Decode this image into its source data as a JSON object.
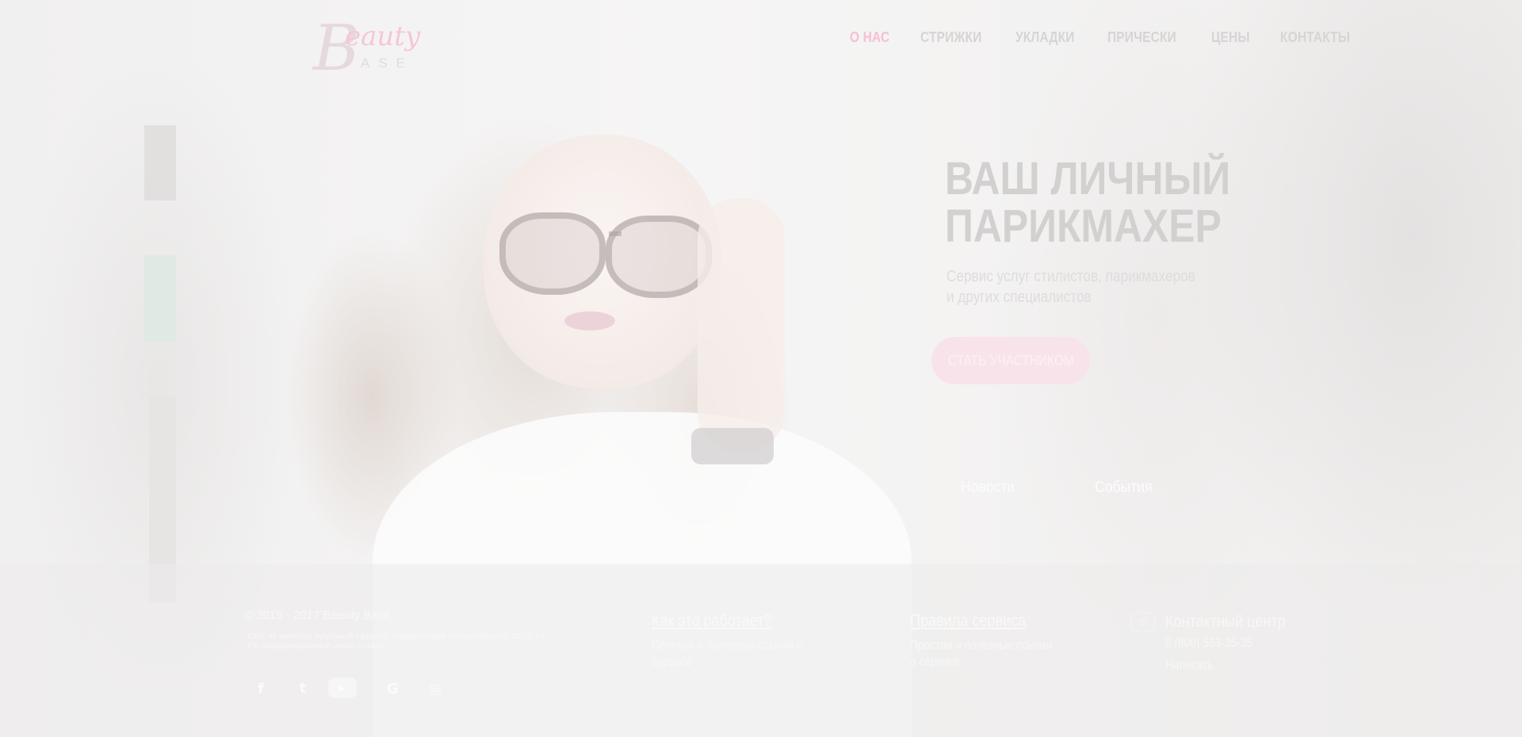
{
  "header": {
    "logo_script": "eauty",
    "logo_letter": "B",
    "logo_sub": "ASE",
    "nav": [
      {
        "label": "О НАС",
        "active": true
      },
      {
        "label": "СТРИЖКИ",
        "active": false
      },
      {
        "label": "УКЛАДКИ",
        "active": false
      },
      {
        "label": "ПРИЧЕСКИ",
        "active": false
      },
      {
        "label": "ЦЕНЫ",
        "active": false
      },
      {
        "label": "КОНТАКТЫ",
        "active": false
      }
    ]
  },
  "hero": {
    "title": "ВАШ ЛИЧНЫЙ\nПАРИКМАХЕР",
    "subtitle": "Сервис услуг стилистов, парикмахеров\nи других специалистов",
    "cta_label": "СТАТЬ УЧАСТНИКОМ",
    "tabs": [
      "Новости",
      "События"
    ]
  },
  "footer": {
    "copyright": "© 2015 - 2017 Beauty Base",
    "legal": "Сайт не является публичной офертой, определяемой положениями ст. 437(2) ГК РФ. Информационный центр — 1431",
    "social": [
      {
        "name": "facebook-icon",
        "glyph": "f"
      },
      {
        "name": "twitter-icon",
        "glyph": "t"
      },
      {
        "name": "youtube-icon",
        "glyph": "▶"
      },
      {
        "name": "google-icon",
        "glyph": "G"
      },
      {
        "name": "instagram-icon",
        "glyph": "◎"
      }
    ],
    "col1": {
      "title": "Как это работает?",
      "text": "Простая и полезные ссылки о сервисе"
    },
    "col2": {
      "title": "Правила сервиса",
      "text": "Простая и полезные ссылки\nо сервисе"
    },
    "contact": {
      "title": "Контактный центр",
      "phone": "8 (800) 553-35-35",
      "extra": "Написать"
    }
  },
  "colors": {
    "accent": "#f6c0d2",
    "nav_text": "#d6d4d4",
    "cta_bg": "#f9e3ea"
  }
}
